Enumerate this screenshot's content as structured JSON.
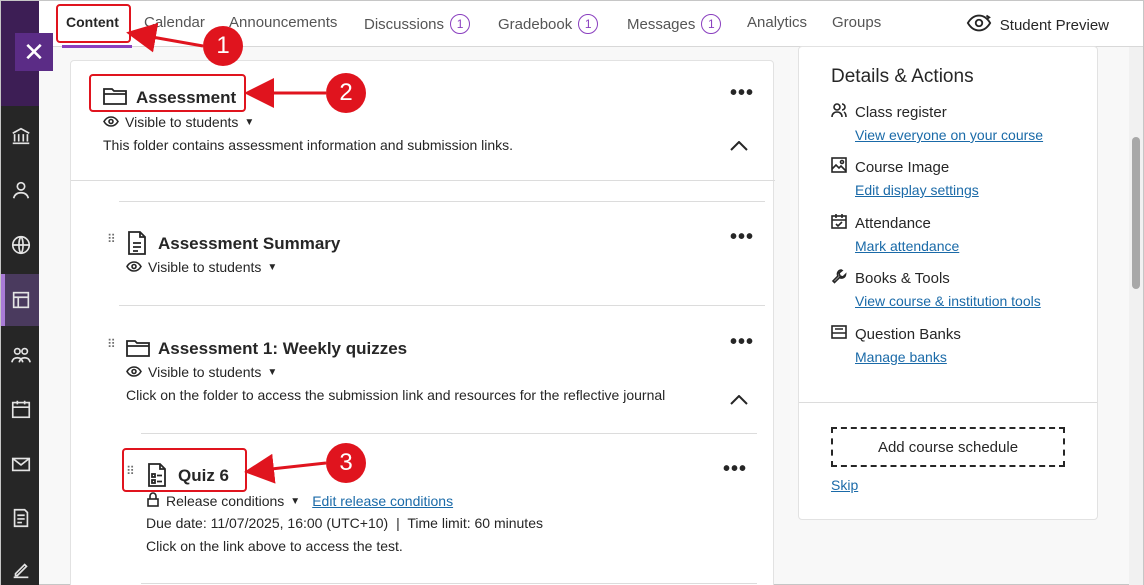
{
  "tabs": [
    {
      "label": "Content",
      "badge": ""
    },
    {
      "label": "Calendar",
      "badge": ""
    },
    {
      "label": "Announcements",
      "badge": ""
    },
    {
      "label": "Discussions",
      "badge": "1"
    },
    {
      "label": "Gradebook",
      "badge": "1"
    },
    {
      "label": "Messages",
      "badge": "1"
    },
    {
      "label": "Analytics",
      "badge": ""
    },
    {
      "label": "Groups",
      "badge": ""
    }
  ],
  "student_preview": "Student Preview",
  "close_glyph": "✕",
  "content": {
    "folder": {
      "title": "Assessment",
      "visibility": "Visible to students",
      "description": "This folder contains assessment information and submission links."
    },
    "summary": {
      "title": "Assessment Summary",
      "visibility": "Visible to students"
    },
    "weekly": {
      "title": "Assessment 1: Weekly quizzes",
      "visibility": "Visible to students",
      "description": "Click on the folder to access the submission link and resources for the reflective journal"
    },
    "quiz": {
      "title": "Quiz 6",
      "release": "Release conditions",
      "edit_release": "Edit release conditions",
      "due": "Due date: 11/07/2025, 16:00 (UTC+10)",
      "time_limit": "Time limit: 60 minutes",
      "separator": "|",
      "note": "Click on the link above to access the test."
    },
    "more_glyph": "•••"
  },
  "details": {
    "title": "Details & Actions",
    "items": [
      {
        "label": "Class register",
        "link": "View everyone on your course",
        "icon": "people-icon"
      },
      {
        "label": "Course Image",
        "link": "Edit display settings",
        "icon": "image-icon"
      },
      {
        "label": "Attendance",
        "link": "Mark attendance",
        "icon": "attendance-icon"
      },
      {
        "label": "Books & Tools",
        "link": "View course & institution tools",
        "icon": "wrench-icon"
      },
      {
        "label": "Question Banks",
        "link": "Manage banks",
        "icon": "question-bank-icon"
      }
    ],
    "schedule_button": "Add course schedule",
    "skip": "Skip"
  },
  "callouts": [
    "1",
    "2",
    "3"
  ],
  "colors": {
    "accent": "#8a3fbf",
    "annotation": "#e0141e",
    "link": "#1a6aa8",
    "nav": "#262626"
  }
}
